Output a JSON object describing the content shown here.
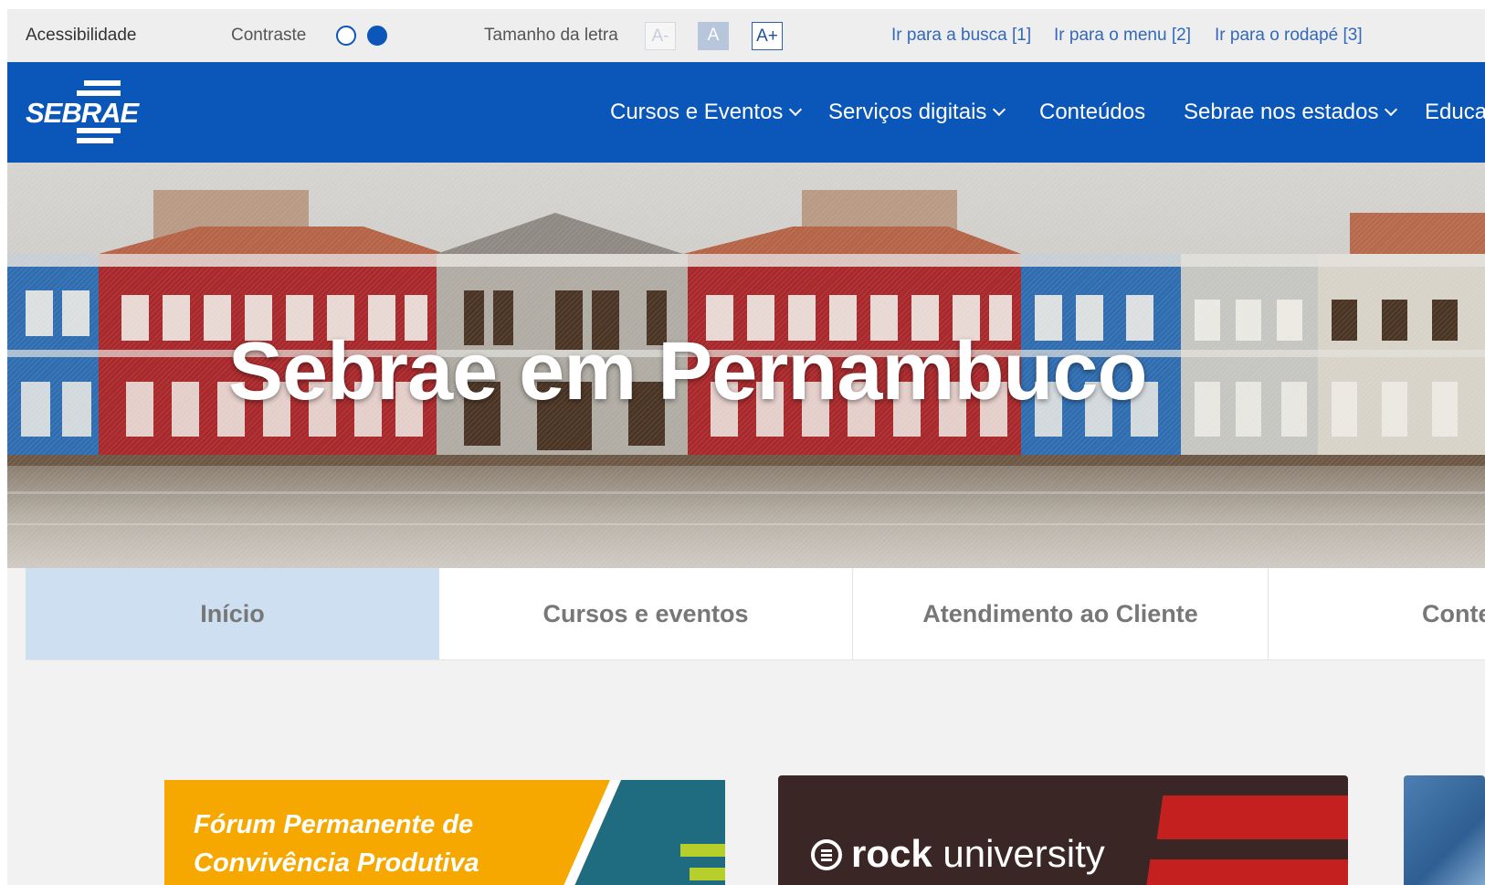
{
  "accessibility": {
    "title": "Acessibilidade",
    "contrast_label": "Contraste",
    "font_size_label": "Tamanho da letra",
    "font_decrease": "A-",
    "font_normal": "A",
    "font_increase": "A+",
    "skip_links": [
      "Ir para a busca [1]",
      "Ir para o menu [2]",
      "Ir para o rodapé [3]"
    ]
  },
  "header": {
    "logo_text": "SEBRAE",
    "nav": [
      "Cursos e Eventos",
      "Serviços digitais",
      "Conteúdos",
      "Sebrae nos estados",
      "Educa"
    ]
  },
  "hero": {
    "title": "Sebrae em Pernambuco"
  },
  "tabs": [
    "Início",
    "Cursos e eventos",
    "Atendimento ao Cliente",
    "Conte"
  ],
  "cards": {
    "forum": {
      "line1": "Fórum Permanente de",
      "line2": "Convivência Produtiva"
    },
    "rock": {
      "brand_bold": "rock",
      "brand_light": " university"
    }
  },
  "colors": {
    "brand_blue": "#0b56b9",
    "active_tab": "#cddff1",
    "forum_orange": "#f6a800",
    "rock_dark": "#3a2624",
    "rock_red": "#c4201f"
  }
}
